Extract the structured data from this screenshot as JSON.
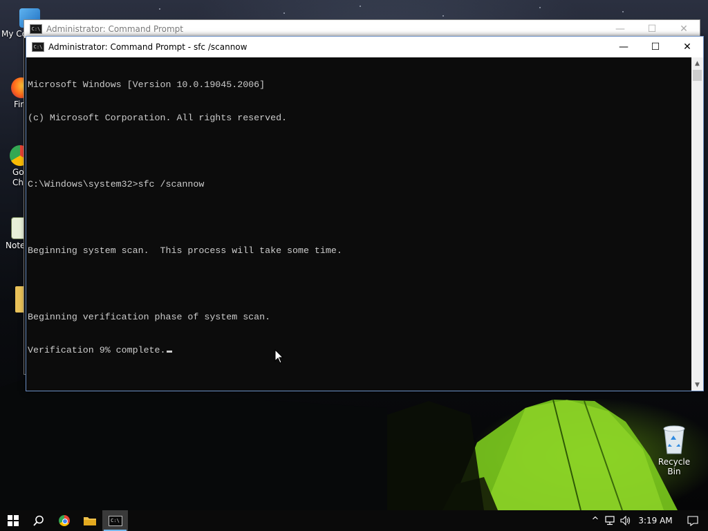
{
  "desktop": {
    "icons": [
      {
        "label": "My Co",
        "icon": "this-pc-icon"
      },
      {
        "label": "Fir",
        "icon": "firefox-icon"
      },
      {
        "label": "Go\nChr",
        "icon": "chrome-icon"
      },
      {
        "label": "Note",
        "icon": "notepad-icon"
      },
      {
        "label": "",
        "icon": "folder-icon"
      }
    ],
    "recycle_bin": {
      "label": "Recycle Bin",
      "icon": "recycle-bin-icon"
    }
  },
  "background_window": {
    "title": "Administrator:  Command Prompt",
    "icon": "console-icon"
  },
  "window": {
    "title": "Administrator:  Command Prompt - sfc  /scannow",
    "icon": "console-icon",
    "minimize": "—",
    "maximize": "☐",
    "close": "✕",
    "console_lines": [
      "Microsoft Windows [Version 10.0.19045.2006]",
      "(c) Microsoft Corporation. All rights reserved.",
      "",
      "C:\\Windows\\system32>sfc /scannow",
      "",
      "Beginning system scan.  This process will take some time.",
      "",
      "Beginning verification phase of system scan.",
      "Verification 9% complete."
    ],
    "text_color": "#cccccc",
    "background_color": "#0c0c0c"
  },
  "taskbar": {
    "buttons": [
      {
        "name": "start",
        "icon": "windows-logo-icon"
      },
      {
        "name": "search",
        "icon": "search-icon"
      },
      {
        "name": "chrome",
        "icon": "chrome-icon"
      },
      {
        "name": "file-explorer",
        "icon": "folder-icon"
      },
      {
        "name": "command-prompt",
        "icon": "console-icon",
        "active": true
      }
    ],
    "tray": {
      "chevron": "^",
      "network_icon": "network-icon",
      "volume_icon": "volume-icon",
      "time": "3:19 AM",
      "notifications_icon": "notification-icon"
    },
    "accent_color": "#76b9ed"
  }
}
